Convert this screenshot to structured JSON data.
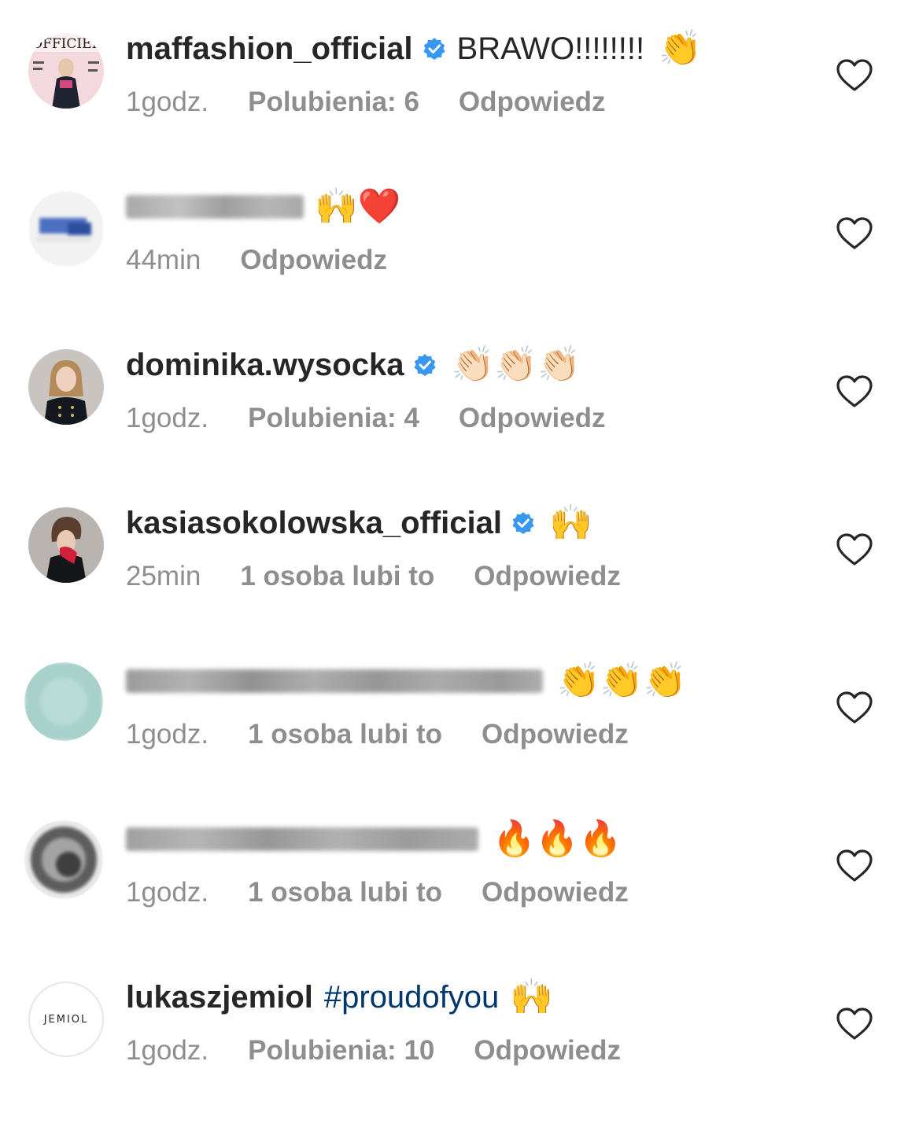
{
  "comments": [
    {
      "username": "maffashion_official",
      "verified": true,
      "text": "BRAWO!!!!!!!!",
      "emoji": "👏",
      "time": "1godz.",
      "likes": "Polubienia: 6",
      "reply": "Odpowiedz",
      "avatar": "magazine-cover-avatar"
    },
    {
      "username_blurred": true,
      "emoji": "🙌❤️",
      "time": "44min",
      "likes": "",
      "reply": "Odpowiedz",
      "avatar": "blurred-avatar"
    },
    {
      "username": "dominika.wysocka",
      "verified": true,
      "text": "",
      "emoji": "👏🏻👏🏻👏🏻",
      "time": "1godz.",
      "likes": "Polubienia: 4",
      "reply": "Odpowiedz",
      "avatar": "woman-portrait-avatar"
    },
    {
      "username": "kasiasokolowska_official",
      "verified": true,
      "text": "",
      "emoji": "🙌",
      "time": "25min",
      "likes": "1 osoba lubi to",
      "reply": "Odpowiedz",
      "avatar": "woman-red-mask-avatar"
    },
    {
      "username_blurred": true,
      "emoji": "👏👏👏",
      "time": "1godz.",
      "likes": "1 osoba lubi to",
      "reply": "Odpowiedz",
      "avatar": "blurred-teal-avatar"
    },
    {
      "username_blurred": true,
      "emoji": "🔥🔥🔥",
      "time": "1godz.",
      "likes": "1 osoba lubi to",
      "reply": "Odpowiedz",
      "avatar": "blurred-grey-avatar"
    },
    {
      "username": "lukaszjemiol",
      "verified": false,
      "hashtag": "#proudofyou",
      "emoji": "🙌",
      "time": "1godz.",
      "likes": "Polubienia: 10",
      "reply": "Odpowiedz",
      "avatar": "jemiol-logo-avatar",
      "avatar_text": "JEMIOL"
    }
  ],
  "colors": {
    "text": "#262626",
    "meta": "#8e8e8e",
    "verified": "#3897f0",
    "hashtag": "#00376b"
  },
  "icons": {
    "verified": "verified-badge-icon",
    "like": "heart-icon"
  }
}
